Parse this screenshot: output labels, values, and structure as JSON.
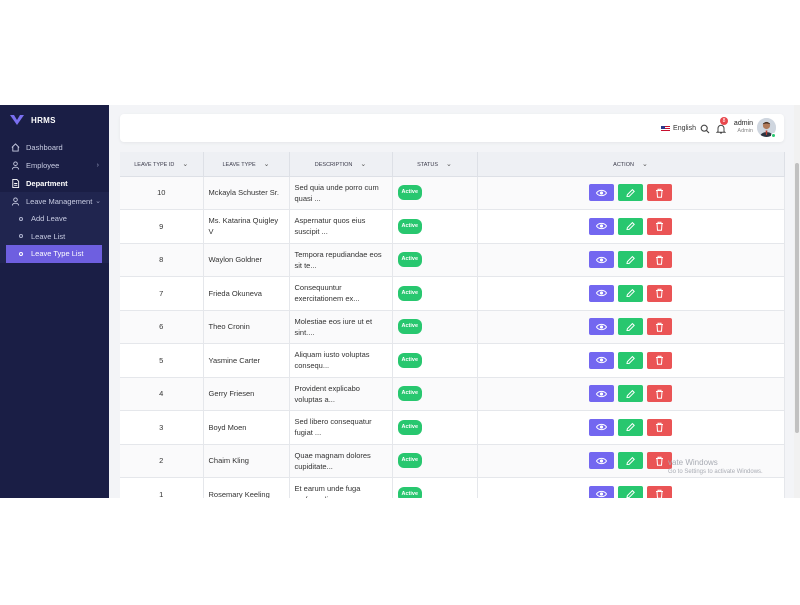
{
  "app": {
    "name": "HRMS"
  },
  "sidebar": {
    "items": [
      {
        "label": "Dashboard",
        "icon": "home-icon"
      },
      {
        "label": "Employee",
        "icon": "user-icon"
      },
      {
        "label": "Department",
        "icon": "document-icon"
      },
      {
        "label": "Leave Management",
        "icon": "user-icon"
      }
    ],
    "subitems": [
      {
        "label": "Add Leave"
      },
      {
        "label": "Leave List"
      },
      {
        "label": "Leave Type List"
      }
    ]
  },
  "topbar": {
    "language": "English",
    "notification_count": "8",
    "user_name": "admin",
    "user_role": "Admin"
  },
  "table": {
    "headers": [
      "LEAVE TYPE ID",
      "LEAVE TYPE",
      "DESCRIPTION",
      "STATUS",
      "ACTION"
    ],
    "rows": [
      {
        "id": "10",
        "type": "Mckayla Schuster Sr.",
        "desc": "Sed quia unde porro cum quasi ...",
        "status": "Active"
      },
      {
        "id": "9",
        "type": "Ms. Katarina Quigley V",
        "desc": "Aspernatur quos eius suscipit ...",
        "status": "Active"
      },
      {
        "id": "8",
        "type": "Waylon Goldner",
        "desc": "Tempora repudiandae eos sit te...",
        "status": "Active"
      },
      {
        "id": "7",
        "type": "Frieda Okuneva",
        "desc": "Consequuntur exercitationem ex...",
        "status": "Active"
      },
      {
        "id": "6",
        "type": "Theo Cronin",
        "desc": "Molestiae eos iure ut et sint....",
        "status": "Active"
      },
      {
        "id": "5",
        "type": "Yasmine Carter",
        "desc": "Aliquam iusto voluptas consequ...",
        "status": "Active"
      },
      {
        "id": "4",
        "type": "Gerry Friesen",
        "desc": "Provident explicabo voluptas a...",
        "status": "Active"
      },
      {
        "id": "3",
        "type": "Boyd Moen",
        "desc": "Sed libero consequatur fugiat ...",
        "status": "Active"
      },
      {
        "id": "2",
        "type": "Chaim Kling",
        "desc": "Quae magnam dolores cupiditate...",
        "status": "Active"
      },
      {
        "id": "1",
        "type": "Rosemary Keeling",
        "desc": "Et earum unde fuga perferendis",
        "status": "Active"
      }
    ]
  },
  "watermark": {
    "line1": "vate Windows",
    "line2": "Go to Settings to activate Windows."
  },
  "colors": {
    "sidebar": "#1a1e45",
    "active": "#6e5fe0",
    "view": "#7367f0",
    "edit": "#28c76f",
    "delete": "#ea5455"
  }
}
